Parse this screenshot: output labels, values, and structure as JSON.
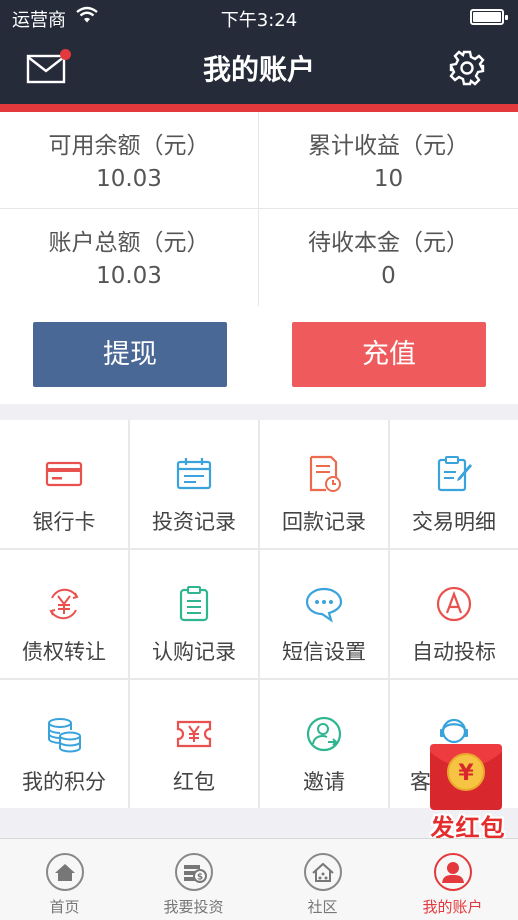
{
  "status_bar": {
    "carrier": "运营商",
    "time": "下午3:24"
  },
  "header": {
    "title": "我的账户",
    "mail_icon": "mail-icon",
    "settings_icon": "gear-icon"
  },
  "summary": [
    {
      "label": "可用余额（元）",
      "value": "10.03"
    },
    {
      "label": "累计收益（元）",
      "value": "10"
    },
    {
      "label": "账户总额（元）",
      "value": "10.03"
    },
    {
      "label": "待收本金（元）",
      "value": "0"
    }
  ],
  "actions": {
    "withdraw": "提现",
    "recharge": "充值"
  },
  "grid": [
    {
      "label": "银行卡",
      "icon": "bank-card-icon"
    },
    {
      "label": "投资记录",
      "icon": "calendar-icon"
    },
    {
      "label": "回款记录",
      "icon": "document-clock-icon"
    },
    {
      "label": "交易明细",
      "icon": "clipboard-pen-icon"
    },
    {
      "label": "债权转让",
      "icon": "yen-exchange-icon"
    },
    {
      "label": "认购记录",
      "icon": "clipboard-list-icon"
    },
    {
      "label": "短信设置",
      "icon": "chat-bubble-icon"
    },
    {
      "label": "自动投标",
      "icon": "auto-bid-icon"
    },
    {
      "label": "我的积分",
      "icon": "coins-icon"
    },
    {
      "label": "红包",
      "icon": "ticket-yen-icon"
    },
    {
      "label": "邀请",
      "icon": "user-invite-icon"
    },
    {
      "label": "客",
      "icon": "customer-service-icon"
    }
  ],
  "red_packet": {
    "label": "发红包",
    "symbol": "¥"
  },
  "tabs": [
    {
      "label": "首页",
      "icon": "home-icon"
    },
    {
      "label": "我要投资",
      "icon": "invest-icon"
    },
    {
      "label": "社区",
      "icon": "community-icon"
    },
    {
      "label": "我的账户",
      "icon": "user-icon",
      "active": true
    }
  ],
  "colors": {
    "header": "#262b3a",
    "accent": "#e4393c",
    "withdraw": "#4a6896",
    "recharge": "#ef5a5c"
  }
}
